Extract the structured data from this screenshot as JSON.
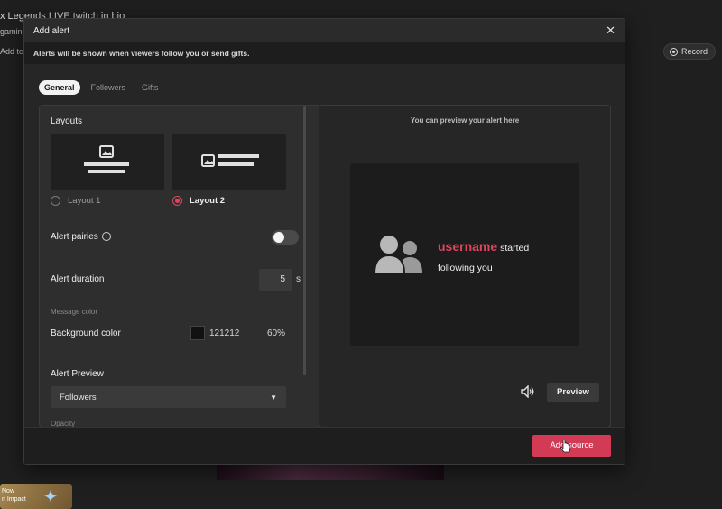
{
  "background": {
    "title": "x Legends LIVE twitch in bio",
    "subtitle": "gamin",
    "add_label": "Add to",
    "record_label": "Record",
    "ad_text": "Now\nn Impact"
  },
  "modal": {
    "title": "Add alert",
    "notice": "Alerts will be shown when viewers follow you or send gifts.",
    "tabs": [
      {
        "label": "General",
        "active": true
      },
      {
        "label": "Followers",
        "active": false
      },
      {
        "label": "Gifts",
        "active": false
      }
    ],
    "layouts": {
      "heading": "Layouts",
      "options": [
        {
          "label": "Layout 1",
          "selected": false
        },
        {
          "label": "Layout 2",
          "selected": true
        }
      ]
    },
    "alert_pairing": {
      "label": "Alert pairies",
      "enabled": false
    },
    "alert_duration": {
      "label": "Alert duration",
      "value": "5",
      "unit": "s"
    },
    "message_color": {
      "label": "Message color"
    },
    "background_color": {
      "label": "Background color",
      "hex": "121212",
      "opacity": "60%",
      "color": "#121212"
    },
    "alert_preview": {
      "label": "Alert Preview",
      "selected": "Followers"
    },
    "opacity_label": "Opacity",
    "preview": {
      "hint": "You can preview your alert here",
      "username": "username",
      "action_1": "started",
      "action_2": "following you",
      "button": "Preview"
    },
    "footer": {
      "add_source": "Add source"
    }
  },
  "colors": {
    "accent": "#e2445c",
    "button": "#d23a56"
  }
}
